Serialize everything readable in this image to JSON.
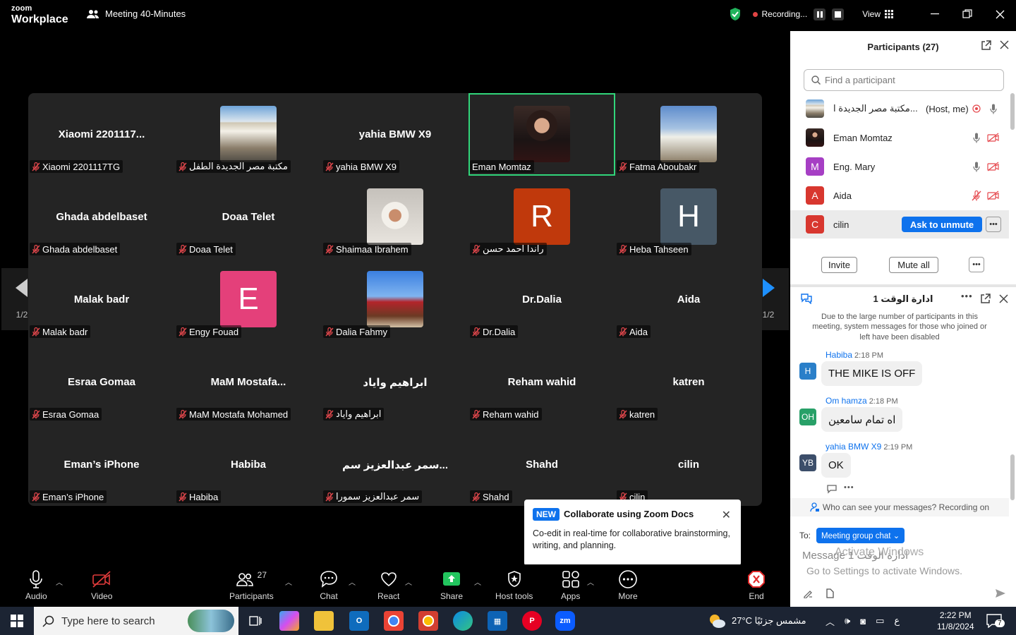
{
  "app": {
    "logo_line1": "zoom",
    "logo_line2": "Workplace",
    "meeting_title": "Meeting 40-Minutes"
  },
  "titlebar": {
    "recording_label": "Recording...",
    "view_label": "View"
  },
  "grid": {
    "tiles": [
      {
        "name": "Xiaomi 2201117...",
        "label": "Xiaomi 2201117TG",
        "avatar": "none"
      },
      {
        "name": "",
        "label": "مكتبة مصر الجديدة الطفل",
        "avatar": "photo-building"
      },
      {
        "name": "yahia BMW  X9",
        "label": "yahia BMW  X9",
        "avatar": "none"
      },
      {
        "name": "",
        "label": "Eman Momtaz",
        "avatar": "photo-woman",
        "active": true
      },
      {
        "name": "",
        "label": "Fatma Aboubakr",
        "avatar": "photo-sculpture"
      },
      {
        "name": "Ghada abdelbaset",
        "label": "Ghada abdelbaset",
        "avatar": "none"
      },
      {
        "name": "Doaa Telet",
        "label": "Doaa Telet",
        "avatar": "none"
      },
      {
        "name": "",
        "label": "Shaimaa Ibrahem",
        "avatar": "photo-woman2"
      },
      {
        "name": "",
        "label": "راندا احمد حسن",
        "avatar": "letter",
        "letter": "R",
        "color": "#c0390c"
      },
      {
        "name": "",
        "label": "Heba Tahseen",
        "avatar": "letter",
        "letter": "H",
        "color": "#475866"
      },
      {
        "name": "Malak badr",
        "label": "Malak badr",
        "avatar": "none"
      },
      {
        "name": "",
        "label": "Engy Fouad",
        "avatar": "letter",
        "letter": "E",
        "color": "#e4407a"
      },
      {
        "name": "",
        "label": "Dalia Fahmy",
        "avatar": "photo-horse"
      },
      {
        "name": "Dr.Dalia",
        "label": "Dr.Dalia",
        "avatar": "none"
      },
      {
        "name": "Aida",
        "label": "Aida",
        "avatar": "none"
      },
      {
        "name": "Esraa Gomaa",
        "label": "Esraa Gomaa",
        "avatar": "none"
      },
      {
        "name": "MaM  Mostafa...",
        "label": "MaM Mostafa Mohamed",
        "avatar": "none"
      },
      {
        "name": "ابراهيم واياد",
        "label": "ابراهيم واياد",
        "avatar": "none"
      },
      {
        "name": "Reham wahid",
        "label": "Reham wahid",
        "avatar": "none"
      },
      {
        "name": "katren",
        "label": "katren",
        "avatar": "none"
      },
      {
        "name": "Eman’s iPhone",
        "label": "Eman’s iPhone",
        "avatar": "none"
      },
      {
        "name": "Habiba",
        "label": "Habiba",
        "avatar": "none"
      },
      {
        "name": "سمر عبدالعزيز سم...",
        "label": "سمر عبدالعزيز سمورا",
        "avatar": "none"
      },
      {
        "name": "Shahd",
        "label": "Shahd",
        "avatar": "none"
      },
      {
        "name": "cilin",
        "label": "cilin",
        "avatar": "none"
      }
    ],
    "page_left": "1/2",
    "page_right": "1/2"
  },
  "toolbar": {
    "audio": "Audio",
    "video": "Video",
    "participants": "Participants",
    "participant_count": "27",
    "chat": "Chat",
    "react": "React",
    "share": "Share",
    "host_tools": "Host tools",
    "apps": "Apps",
    "more": "More",
    "end": "End"
  },
  "popup": {
    "badge": "NEW",
    "title": "Collaborate using Zoom Docs",
    "body": "Co-edit in real-time for collaborative brainstorming, writing, and planning."
  },
  "participants_panel": {
    "title": "Participants (27)",
    "search_placeholder": "Find a participant",
    "rows": [
      {
        "name": "مكتبة مصر الجديدة ا...",
        "role": "(Host, me)",
        "avatar": "photo-building"
      },
      {
        "name": "Eman Momtaz",
        "avatar": "photo-woman"
      },
      {
        "name": "Eng. Mary",
        "avatar": "letter",
        "letter": "M",
        "color": "#a63fc4"
      },
      {
        "name": "Aida",
        "avatar": "letter",
        "letter": "A",
        "color": "#d8372f"
      },
      {
        "name": "cilin",
        "avatar": "letter",
        "letter": "C",
        "color": "#d8372f"
      }
    ],
    "ask_to_unmute": "Ask to unmute",
    "invite": "Invite",
    "mute_all": "Mute all"
  },
  "chat": {
    "title": "ادارة الوقت 1",
    "system_message": "Due to the large number of participants in this meeting, system messages for those who joined or left have been disabled",
    "messages": [
      {
        "sender": "Habiba",
        "time": "2:18 PM",
        "text": "THE MIKE IS OFF",
        "initials": "H",
        "color": "#2a7fc9"
      },
      {
        "sender": "Om hamza",
        "time": "2:18 PM",
        "text": "اه تمام سامعين",
        "initials": "OH",
        "color": "#28a068"
      },
      {
        "sender": "yahia BMW   X9",
        "time": "2:19 PM",
        "text": "OK",
        "initials": "YB",
        "color": "#3c4e6a"
      }
    ],
    "who_can_see": "Who can see your messages? Recording on",
    "to_label": "To:",
    "to_value": "Meeting group chat",
    "message_placeholder": "Message ادارة الوقت 1",
    "activate_windows_1": "Activate Windows",
    "activate_windows_2": "Go to Settings to activate Windows."
  },
  "taskbar": {
    "search_placeholder": "Type here to search",
    "weather": "27°C  مشمس جزئيًا",
    "lang": "ع",
    "time": "2:22 PM",
    "date": "11/8/2024",
    "notif_count": "7"
  }
}
